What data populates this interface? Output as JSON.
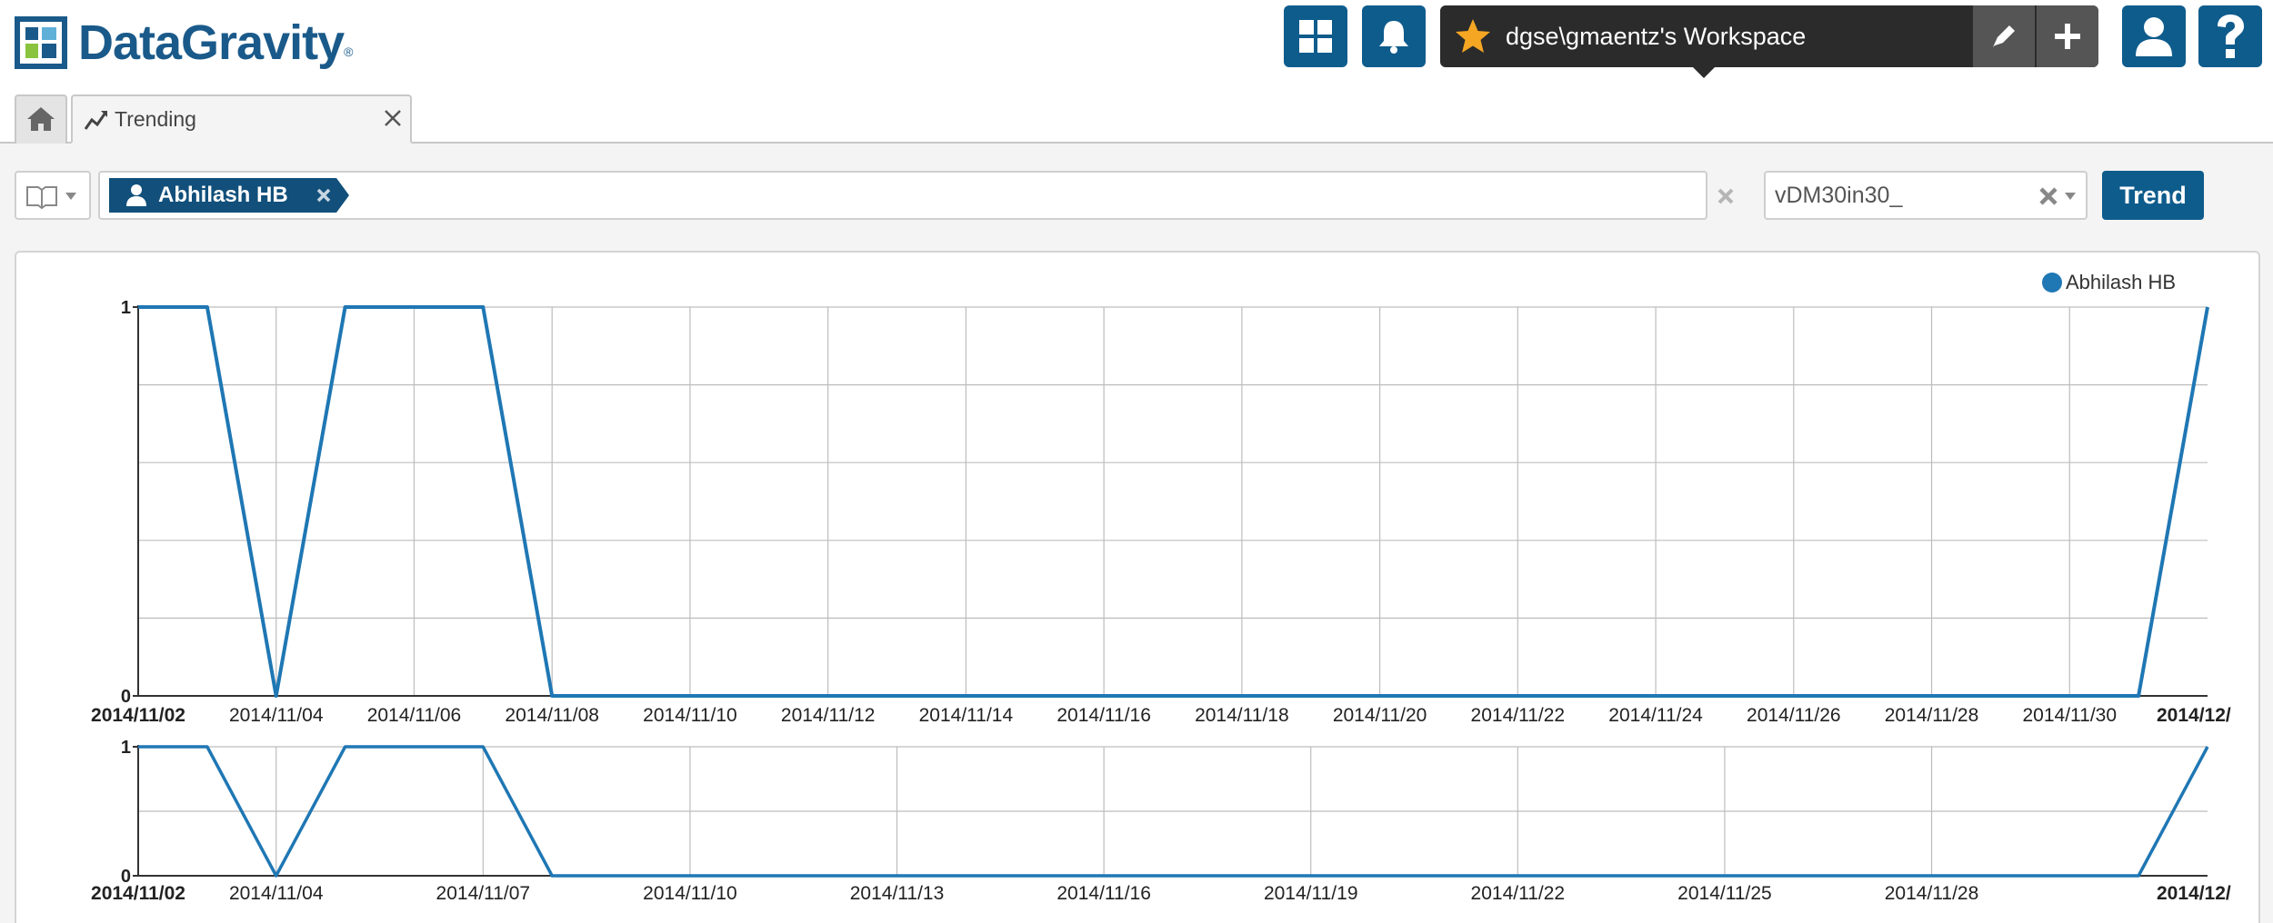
{
  "header": {
    "logo_text": "DataGravity",
    "logo_mark": "®",
    "workspace_label": "dgse\\gmaentz's Workspace"
  },
  "tabs": [
    {
      "label": "Trending"
    }
  ],
  "search": {
    "chip_label": "Abhilash HB",
    "select_value": "vDM30in30_",
    "trend_button": "Trend"
  },
  "chart_data": [
    {
      "type": "line",
      "series": [
        {
          "name": "Abhilash HB",
          "color": "#1f77b4",
          "x": [
            "2014/11/02",
            "2014/11/03",
            "2014/11/04",
            "2014/11/05",
            "2014/11/06",
            "2014/11/07",
            "2014/11/08",
            "2014/11/09",
            "2014/11/10",
            "2014/11/11",
            "2014/11/12",
            "2014/11/13",
            "2014/11/14",
            "2014/11/15",
            "2014/11/16",
            "2014/11/17",
            "2014/11/18",
            "2014/11/19",
            "2014/11/20",
            "2014/11/21",
            "2014/11/22",
            "2014/11/23",
            "2014/11/24",
            "2014/11/25",
            "2014/11/26",
            "2014/11/27",
            "2014/11/28",
            "2014/11/29",
            "2014/11/30",
            "2014/12/01",
            "2014/12/02"
          ],
          "values": [
            1,
            1,
            0,
            1,
            1,
            1,
            0,
            0,
            0,
            0,
            0,
            0,
            0,
            0,
            0,
            0,
            0,
            0,
            0,
            0,
            0,
            0,
            0,
            0,
            0,
            0,
            0,
            0,
            0,
            0,
            1
          ]
        }
      ],
      "legend": "top-right",
      "grid": true,
      "ylim": [
        0,
        1
      ],
      "y_ticks": [
        "0",
        "1"
      ],
      "x_ticks": [
        "2014/11/02",
        "2014/11/04",
        "2014/11/06",
        "2014/11/08",
        "2014/11/10",
        "2014/11/12",
        "2014/11/14",
        "2014/11/16",
        "2014/11/18",
        "2014/11/20",
        "2014/11/22",
        "2014/11/24",
        "2014/11/26",
        "2014/11/28",
        "2014/11/30",
        "2014/12/"
      ]
    },
    {
      "type": "line",
      "series": [
        {
          "name": "Abhilash HB",
          "color": "#1f77b4",
          "x": [
            "2014/11/02",
            "2014/11/03",
            "2014/11/04",
            "2014/11/05",
            "2014/11/06",
            "2014/11/07",
            "2014/11/08",
            "2014/11/09",
            "2014/11/10",
            "2014/11/11",
            "2014/11/12",
            "2014/11/13",
            "2014/11/14",
            "2014/11/15",
            "2014/11/16",
            "2014/11/17",
            "2014/11/18",
            "2014/11/19",
            "2014/11/20",
            "2014/11/21",
            "2014/11/22",
            "2014/11/23",
            "2014/11/24",
            "2014/11/25",
            "2014/11/26",
            "2014/11/27",
            "2014/11/28",
            "2014/11/29",
            "2014/11/30",
            "2014/12/01",
            "2014/12/02"
          ],
          "values": [
            1,
            1,
            0,
            1,
            1,
            1,
            0,
            0,
            0,
            0,
            0,
            0,
            0,
            0,
            0,
            0,
            0,
            0,
            0,
            0,
            0,
            0,
            0,
            0,
            0,
            0,
            0,
            0,
            0,
            0,
            1
          ]
        }
      ],
      "grid": true,
      "ylim": [
        0,
        1
      ],
      "y_ticks": [
        "0",
        "1"
      ],
      "x_ticks": [
        "2014/11/02",
        "2014/11/04",
        "2014/11/07",
        "2014/11/10",
        "2014/11/13",
        "2014/11/16",
        "2014/11/19",
        "2014/11/22",
        "2014/11/25",
        "2014/11/28",
        "2014/12/"
      ]
    }
  ]
}
